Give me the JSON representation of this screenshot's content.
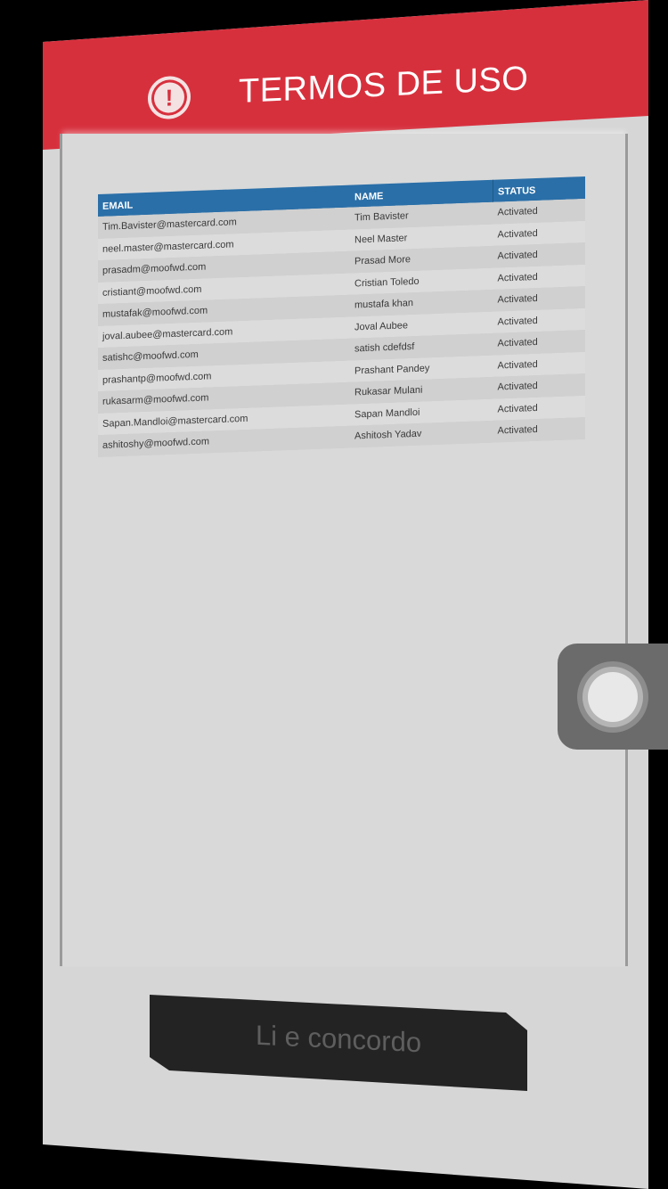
{
  "header": {
    "title": "TERMOS DE USO",
    "icon": "alert-icon",
    "icon_glyph": "!"
  },
  "colors": {
    "header_red": "#d7303d",
    "table_header_blue": "#2a6fa8",
    "button_dark": "#232323"
  },
  "table": {
    "headers": [
      "EMAIL",
      "NAME",
      "STATUS"
    ],
    "rows": [
      [
        "Tim.Bavister@mastercard.com",
        "Tim Bavister",
        "Activated"
      ],
      [
        "neel.master@mastercard.com",
        "Neel Master",
        "Activated"
      ],
      [
        "prasadm@moofwd.com",
        "Prasad More",
        "Activated"
      ],
      [
        "cristiant@moofwd.com",
        "Cristian Toledo",
        "Activated"
      ],
      [
        "mustafak@moofwd.com",
        "mustafa khan",
        "Activated"
      ],
      [
        "joval.aubee@mastercard.com",
        "Joval Aubee",
        "Activated"
      ],
      [
        "satishc@moofwd.com",
        "satish cdefdsf",
        "Activated"
      ],
      [
        "prashantp@moofwd.com",
        "Prashant Pandey",
        "Activated"
      ],
      [
        "rukasarm@moofwd.com",
        "Rukasar Mulani",
        "Activated"
      ],
      [
        "Sapan.Mandloi@mastercard.com",
        "Sapan Mandloi",
        "Activated"
      ],
      [
        "ashitoshy@moofwd.com",
        "Ashitosh  Yadav",
        "Activated"
      ]
    ]
  },
  "footer": {
    "agree_label": "Li e concordo"
  },
  "overlay": {
    "assistive_touch_icon": "assistive-touch-icon"
  }
}
